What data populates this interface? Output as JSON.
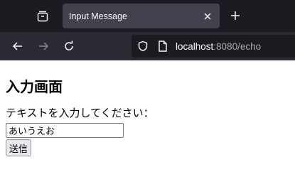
{
  "browser": {
    "tab_title": "Input Message",
    "url_host": "localhost",
    "url_rest": ":8080/echo"
  },
  "page": {
    "title": "入力画面",
    "prompt": "テキストを入力してください：",
    "input_value": "あいうえお",
    "submit_label": "送信"
  },
  "colors": {
    "tab_strip": "#1c1b22",
    "active_tab": "#42414d",
    "nav_bar": "#2b2a33",
    "url_bar": "#1c1b22"
  }
}
